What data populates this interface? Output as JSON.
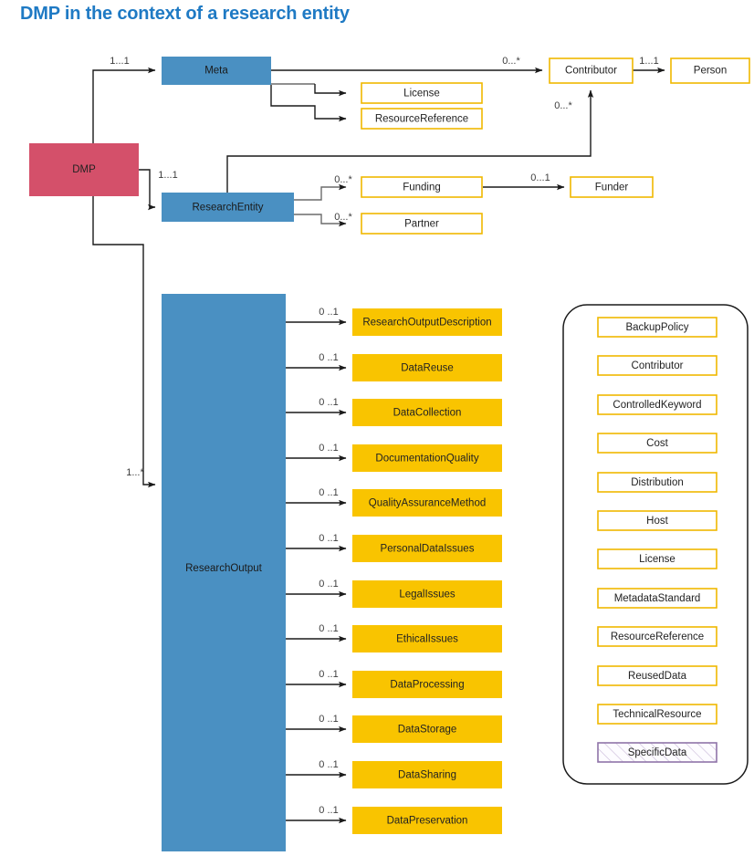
{
  "title": "DMP in the context of a research entity",
  "colors": {
    "title": "#1f7ac4",
    "blue_entity": "#4a90c2",
    "red_entity": "#d4506a",
    "yellow_filled": "#f9c400",
    "yellow_outline_border": "#f0b800",
    "specific_data_border": "#8f74a8",
    "edge": "#1a1a1a",
    "edge_gray": "#6b6b6b"
  },
  "nodes": {
    "dmp": {
      "label": "DMP",
      "style": "red"
    },
    "meta": {
      "label": "Meta",
      "style": "blue"
    },
    "research_entity": {
      "label": "ResearchEntity",
      "style": "blue"
    },
    "research_output": {
      "label": "ResearchOutput",
      "style": "blue"
    },
    "license": {
      "label": "License",
      "style": "yellow-outline"
    },
    "resource_reference": {
      "label": "ResourceReference",
      "style": "yellow-outline"
    },
    "contributor": {
      "label": "Contributor",
      "style": "yellow-outline"
    },
    "person": {
      "label": "Person",
      "style": "yellow-outline"
    },
    "funding": {
      "label": "Funding",
      "style": "yellow-outline"
    },
    "funder": {
      "label": "Funder",
      "style": "yellow-outline"
    },
    "partner": {
      "label": "Partner",
      "style": "yellow-outline"
    }
  },
  "research_output_children": [
    {
      "label": "ResearchOutputDescription",
      "multiplicity": "0 ..1"
    },
    {
      "label": "DataReuse",
      "multiplicity": "0 ..1"
    },
    {
      "label": "DataCollection",
      "multiplicity": "0 ..1"
    },
    {
      "label": "DocumentationQuality",
      "multiplicity": "0 ..1"
    },
    {
      "label": "QualityAssuranceMethod",
      "multiplicity": "0 ..1"
    },
    {
      "label": "PersonalDataIssues",
      "multiplicity": "0 ..1"
    },
    {
      "label": "LegalIssues",
      "multiplicity": "0 ..1"
    },
    {
      "label": "EthicalIssues",
      "multiplicity": "0 ..1"
    },
    {
      "label": "DataProcessing",
      "multiplicity": "0 ..1"
    },
    {
      "label": "DataStorage",
      "multiplicity": "0 ..1"
    },
    {
      "label": "DataSharing",
      "multiplicity": "0 ..1"
    },
    {
      "label": "DataPreservation",
      "multiplicity": "0 ..1"
    }
  ],
  "edge_multiplicities": {
    "dmp_to_meta": "1...1",
    "dmp_to_research_entity": "1...1",
    "dmp_to_research_output": "1...*",
    "meta_to_contributor": "0...*",
    "contributor_to_person": "1...1",
    "research_entity_to_contributor": "0...*",
    "research_entity_to_funding": "0...*",
    "research_entity_to_partner": "0...*",
    "funding_to_funder": "0...1"
  },
  "legend": {
    "items": [
      {
        "label": "BackupPolicy",
        "style": "yellow-outline"
      },
      {
        "label": "Contributor",
        "style": "yellow-outline"
      },
      {
        "label": "ControlledKeyword",
        "style": "yellow-outline"
      },
      {
        "label": "Cost",
        "style": "yellow-outline"
      },
      {
        "label": "Distribution",
        "style": "yellow-outline"
      },
      {
        "label": "Host",
        "style": "yellow-outline"
      },
      {
        "label": "License",
        "style": "yellow-outline"
      },
      {
        "label": "MetadataStandard",
        "style": "yellow-outline"
      },
      {
        "label": "ResourceReference",
        "style": "yellow-outline"
      },
      {
        "label": "ReusedData",
        "style": "yellow-outline"
      },
      {
        "label": "TechnicalResource",
        "style": "yellow-outline"
      },
      {
        "label": "SpecificData",
        "style": "hatched-purple"
      }
    ]
  }
}
